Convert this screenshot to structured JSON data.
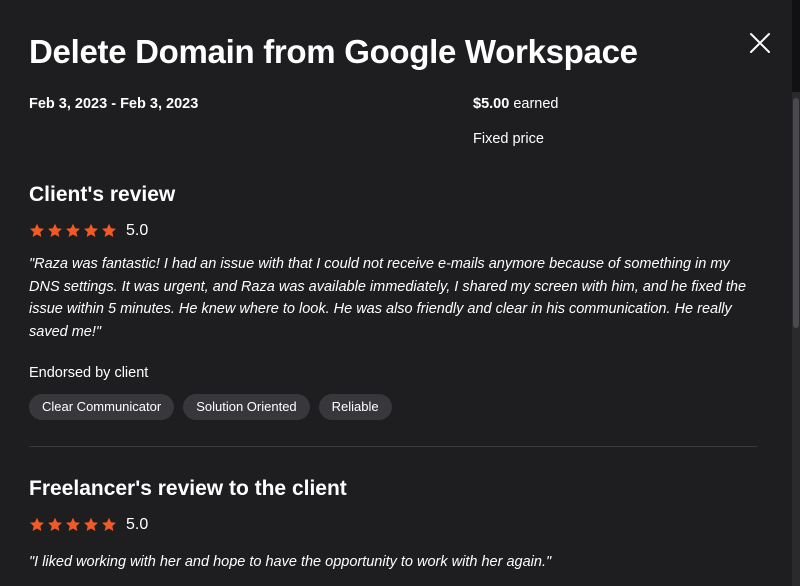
{
  "modal": {
    "title": "Delete Domain from Google Workspace",
    "dates": "Feb 3, 2023 - Feb 3, 2023",
    "earned_amount": "$5.00",
    "earned_suffix": " earned",
    "price_type": "Fixed price"
  },
  "client_review": {
    "heading": "Client's review",
    "rating": 5.0,
    "rating_text": "5.0",
    "text": "\"Raza was fantastic! I had an issue with that I could not receive e-mails anymore because of something in my DNS settings. It was urgent, and Raza was available immediately, I shared my screen with him, and he fixed the issue within 5 minutes. He knew where to look. He was also friendly and clear in his communication. He really saved me!\"",
    "endorsed_label": "Endorsed by client",
    "endorsements": [
      "Clear Communicator",
      "Solution Oriented",
      "Reliable"
    ]
  },
  "freelancer_review": {
    "heading": "Freelancer's review to the client",
    "rating": 5.0,
    "rating_text": "5.0",
    "text": "\"I liked working with her and hope to have the opportunity to work with her again.\""
  },
  "icons": {
    "close": "close-icon",
    "star": "star-icon"
  },
  "colors": {
    "background": "#1e1d20",
    "star": "#f15a24",
    "chip": "#38373b",
    "text": "#ffffff"
  }
}
